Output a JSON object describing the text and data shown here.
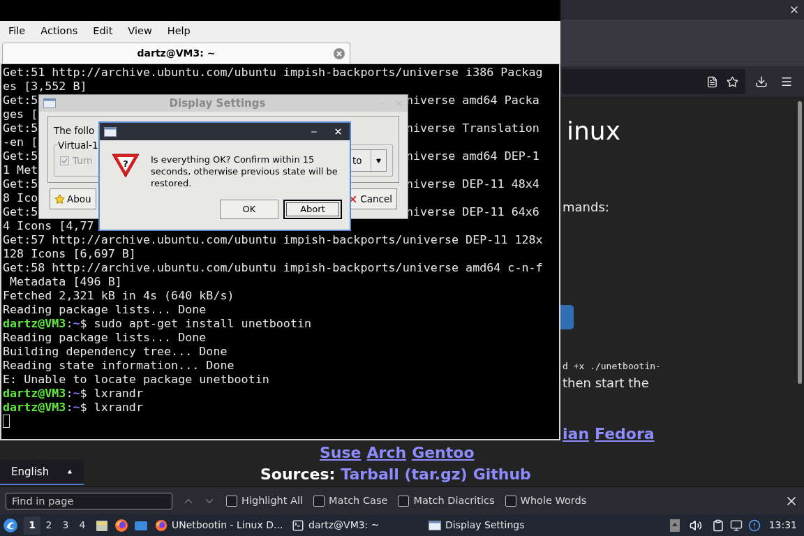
{
  "browser": {
    "page": [
      {
        "kind": "heading",
        "text": "inux"
      },
      {
        "kind": "text",
        "text": "mands:"
      },
      {
        "kind": "button"
      },
      {
        "kind": "code",
        "text": "d +x ./unetbootin-"
      },
      {
        "kind": "text",
        "text": "then start the"
      },
      {
        "kind": "links",
        "items": [
          "ian",
          "Fedora"
        ]
      },
      {
        "kind": "links",
        "items": [
          "Suse",
          "Arch",
          "Gentoo"
        ]
      },
      {
        "kind": "sources",
        "label": "Sources:",
        "items": [
          "Tarball (tar.gz)",
          "Github"
        ]
      }
    ],
    "language": {
      "value": "English"
    },
    "find_bar": {
      "placeholder": "Find in page",
      "options": [
        {
          "label": "Highlight All",
          "checked": false
        },
        {
          "label": "Match Case",
          "checked": false
        },
        {
          "label": "Match Diacritics",
          "checked": false
        },
        {
          "label": "Whole Words",
          "checked": false
        }
      ]
    }
  },
  "terminal": {
    "menu": [
      "File",
      "Actions",
      "Edit",
      "View",
      "Help"
    ],
    "tab": {
      "title": "dartz@VM3: ~",
      "selected": true
    },
    "lines": [
      {
        "kind": "text",
        "left": "Get:51 http://archive.ubuntu.com/ubuntu impish-backports/universe i386 Packag"
      },
      {
        "kind": "text",
        "left": "es [3,552 B]"
      },
      {
        "kind": "text",
        "left": "Get:5",
        "right": "niverse amd64 Packa"
      },
      {
        "kind": "text",
        "left": "ges ["
      },
      {
        "kind": "text",
        "left": "Get:5",
        "right": "niverse Translation"
      },
      {
        "kind": "text",
        "left": "-en ["
      },
      {
        "kind": "text",
        "left": "Get:5",
        "right": "niverse amd64 DEP-1"
      },
      {
        "kind": "text",
        "left": "1 Met"
      },
      {
        "kind": "text",
        "left": "Get:5",
        "right": "niverse DEP-11 48x4"
      },
      {
        "kind": "text",
        "left": "8 Ico"
      },
      {
        "kind": "text",
        "left": "Get:5",
        "right": "niverse DEP-11 64x6"
      },
      {
        "kind": "text",
        "left": "4 Icons [4,77"
      },
      {
        "kind": "text",
        "left": "Get:57 http://archive.ubuntu.com/ubuntu impish-backports/universe DEP-11 128x"
      },
      {
        "kind": "text",
        "left": "128 Icons [6,697 B]"
      },
      {
        "kind": "text",
        "left": "Get:58 http://archive.ubuntu.com/ubuntu impish-backports/universe amd64 c-n-f"
      },
      {
        "kind": "text",
        "left": " Metadata [496 B]"
      },
      {
        "kind": "text",
        "left": "Fetched 2,321 kB in 4s (640 kB/s)"
      },
      {
        "kind": "text",
        "left": "Reading package lists... Done"
      },
      {
        "kind": "prompt",
        "user": "dartz@VM3",
        "sep": ":",
        "path": "~",
        "symbol": "$",
        "command": " sudo apt-get install unetbootin"
      },
      {
        "kind": "text",
        "left": "Reading package lists... Done"
      },
      {
        "kind": "text",
        "left": "Building dependency tree... Done"
      },
      {
        "kind": "text",
        "left": "Reading state information... Done"
      },
      {
        "kind": "text",
        "left": "E: Unable to locate package unetbootin"
      },
      {
        "kind": "prompt",
        "user": "dartz@VM3",
        "sep": ":",
        "path": "~",
        "symbol": "$",
        "command": " lxrandr"
      },
      {
        "kind": "prompt",
        "user": "dartz@VM3",
        "sep": ":",
        "path": "~",
        "symbol": "$",
        "command": " lxrandr"
      },
      {
        "kind": "cursor"
      }
    ]
  },
  "display_settings": {
    "title": "Display Settings",
    "intro": "The follo",
    "group": "Virtual-1",
    "checkbox": {
      "label": "Turn",
      "checked": true,
      "disabled": true
    },
    "combo": {
      "value": "to"
    },
    "buttons": [
      {
        "kind": "about",
        "label": "Abou"
      },
      {
        "kind": "cancel",
        "label": "Cancel"
      }
    ]
  },
  "confirm_dialog": {
    "message": "Is everything OK? Confirm within 15 seconds, otherwise previous state will be restored.",
    "icon_glyph": "?",
    "buttons": [
      {
        "label": "OK",
        "focused": false
      },
      {
        "label": "Abort",
        "focused": true
      }
    ]
  },
  "taskbar": {
    "workspaces": [
      {
        "label": "1",
        "selected": true
      },
      {
        "label": "2",
        "selected": false
      },
      {
        "label": "3",
        "selected": false
      },
      {
        "label": "4",
        "selected": false
      }
    ],
    "tasks": [
      {
        "kind": "browser",
        "title": "UNetbootin - Linux D..."
      },
      {
        "kind": "terminal",
        "title": "dartz@VM3: ~"
      },
      {
        "kind": "window",
        "title": "Display Settings"
      }
    ],
    "clock": "13:31"
  }
}
